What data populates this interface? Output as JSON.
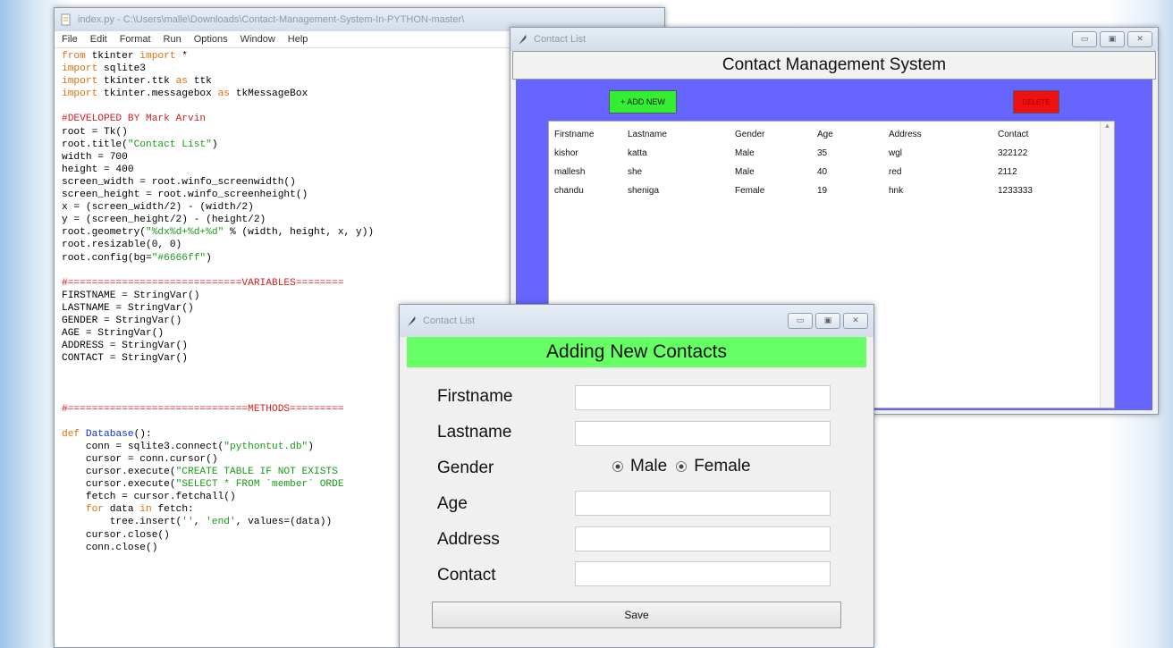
{
  "editor": {
    "title": "index.py - C:\\Users\\malle\\Downloads\\Contact-Management-System-In-PYTHON-master\\",
    "menu": [
      "File",
      "Edit",
      "Format",
      "Run",
      "Options",
      "Window",
      "Help"
    ]
  },
  "contact_list": {
    "window_title": "Contact List",
    "heading": "Contact Management System",
    "add_button": "+ ADD NEW",
    "delete_button": "DELETE",
    "columns": [
      "Firstname",
      "Lastname",
      "Gender",
      "Age",
      "Address",
      "Contact"
    ],
    "rows": [
      [
        "kishor",
        "katta",
        "Male",
        "35",
        "wgl",
        "322122"
      ],
      [
        "mallesh",
        "she",
        "Male",
        "40",
        "red",
        "2112"
      ],
      [
        "chandu",
        "sheniga",
        "Female",
        "19",
        "hnk",
        "1233333"
      ]
    ]
  },
  "dialog": {
    "window_title": "Contact List",
    "heading": "Adding New Contacts",
    "labels": {
      "firstname": "Firstname",
      "lastname": "Lastname",
      "gender": "Gender",
      "age": "Age",
      "address": "Address",
      "contact": "Contact"
    },
    "gender_options": [
      "Male",
      "Female"
    ],
    "save_button": "Save"
  },
  "colors": {
    "panel_blue": "#6666ff",
    "heading_green": "#66ff66",
    "add_green": "#33ee33",
    "delete_red": "#ee1111"
  },
  "icons": {
    "window_icon": "feather-icon",
    "minimize": "minimize-icon",
    "maximize": "maximize-icon",
    "close": "close-icon"
  }
}
